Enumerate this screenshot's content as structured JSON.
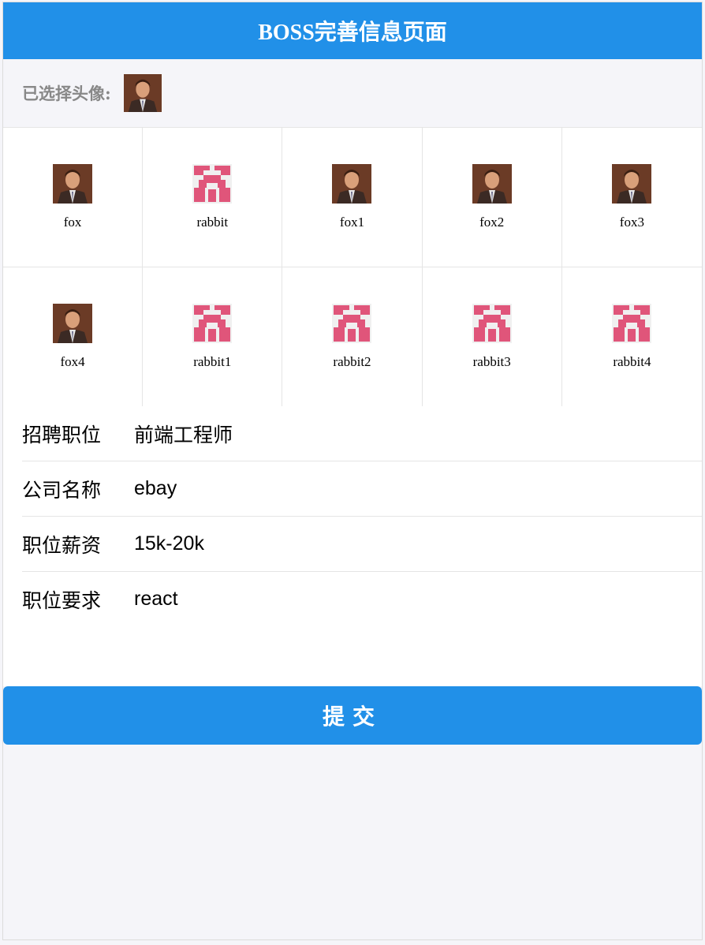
{
  "navbar": {
    "title": "BOSS完善信息页面"
  },
  "selected": {
    "label": "已选择头像:",
    "avatar": "fox"
  },
  "avatars": [
    {
      "name": "fox",
      "icon": "fox-portrait-icon"
    },
    {
      "name": "rabbit",
      "icon": "rabbit-pattern-icon"
    },
    {
      "name": "fox1",
      "icon": "fox-portrait-icon"
    },
    {
      "name": "fox2",
      "icon": "fox-portrait-icon"
    },
    {
      "name": "fox3",
      "icon": "fox-portrait-icon"
    },
    {
      "name": "fox4",
      "icon": "fox-portrait-icon"
    },
    {
      "name": "rabbit1",
      "icon": "rabbit-pattern-icon"
    },
    {
      "name": "rabbit2",
      "icon": "rabbit-pattern-icon"
    },
    {
      "name": "rabbit3",
      "icon": "rabbit-pattern-icon"
    },
    {
      "name": "rabbit4",
      "icon": "rabbit-pattern-icon"
    }
  ],
  "form": {
    "title_label": "招聘职位",
    "title_value": "前端工程师",
    "company_label": "公司名称",
    "company_value": "ebay",
    "salary_label": "职位薪资",
    "salary_value": "15k-20k",
    "desc_label": "职位要求",
    "desc_value": "react"
  },
  "submit": {
    "label": "提交"
  },
  "colors": {
    "primary": "#2190e8",
    "background": "#f5f5f9",
    "rabbit": "#e0557a"
  }
}
